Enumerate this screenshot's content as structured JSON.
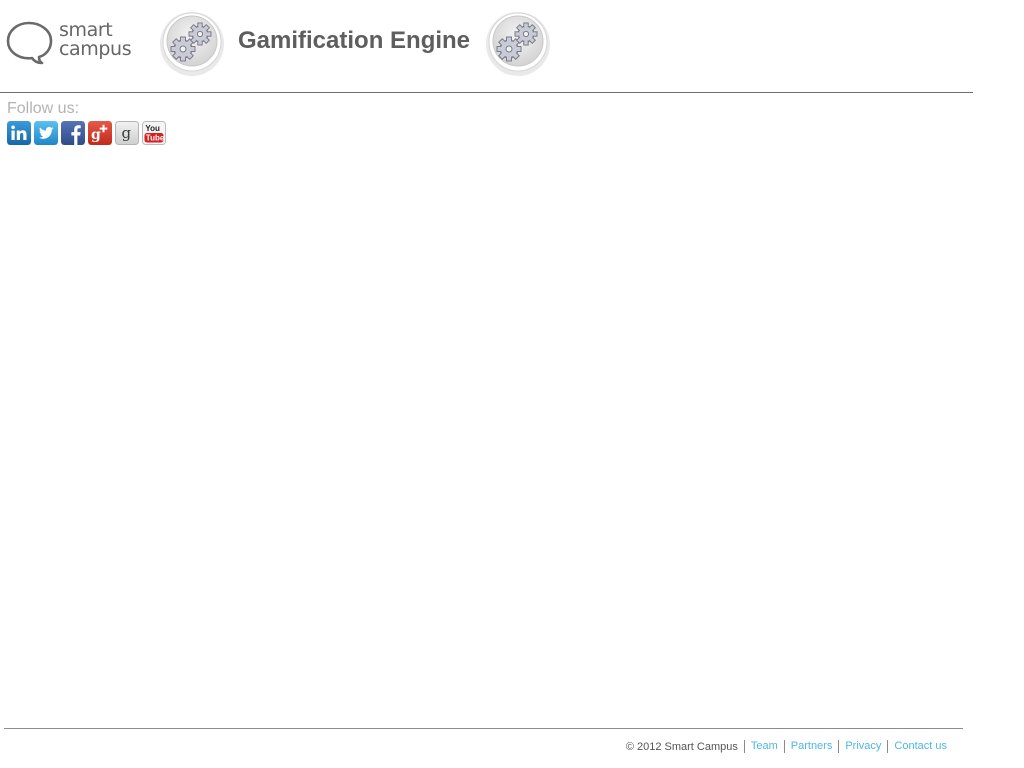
{
  "header": {
    "logo": {
      "line1": "smart",
      "line2": "campus",
      "icon": "speech-bubble-icon"
    },
    "title": "Gamification Engine",
    "badge_icon": "gears-icon"
  },
  "follow": {
    "label": "Follow us:",
    "networks": [
      {
        "name": "LinkedIn",
        "icon": "linkedin-icon",
        "color": "#1a7fbf"
      },
      {
        "name": "Twitter",
        "icon": "twitter-icon",
        "color": "#3aa3e3"
      },
      {
        "name": "Facebook",
        "icon": "facebook-icon",
        "color": "#3b5998"
      },
      {
        "name": "Google+",
        "icon": "google-plus-icon",
        "color": "#d3382a"
      },
      {
        "name": "Goodreads",
        "icon": "goodreads-icon",
        "color": "#e3e3e3"
      },
      {
        "name": "YouTube",
        "icon": "youtube-icon",
        "color": "#cc181e"
      }
    ]
  },
  "footer": {
    "copyright": "© 2012 Smart Campus",
    "links": [
      "Team",
      "Partners",
      "Privacy",
      "Contact us"
    ]
  },
  "colors": {
    "title": "#5e5e5e",
    "follow_label": "#b3b3b3",
    "footer_link": "#4cb8e4",
    "footer_text": "#555555"
  }
}
